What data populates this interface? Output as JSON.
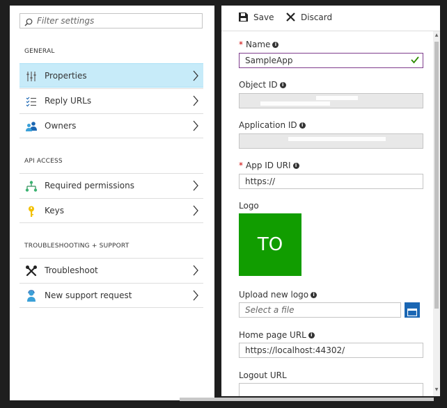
{
  "filter": {
    "placeholder": "Filter settings"
  },
  "sections": {
    "general": "GENERAL",
    "api_access": "API ACCESS",
    "troubleshooting": "TROUBLESHOOTING + SUPPORT"
  },
  "nav": {
    "properties": "Properties",
    "reply_urls": "Reply URLs",
    "owners": "Owners",
    "required_permissions": "Required permissions",
    "keys": "Keys",
    "troubleshoot": "Troubleshoot",
    "new_support_request": "New support request"
  },
  "toolbar": {
    "save": "Save",
    "discard": "Discard"
  },
  "form": {
    "name_label": "Name",
    "name_value": "SampleApp",
    "object_id_label": "Object ID",
    "object_id_value": "        ",
    "application_id_label": "Application ID",
    "application_id_value": "        ",
    "app_id_uri_label": "App ID URI",
    "app_id_uri_value": "https://",
    "logo_label": "Logo",
    "logo_text": "TO",
    "upload_logo_label": "Upload new logo",
    "upload_placeholder": "Select a file",
    "home_page_label": "Home page URL",
    "home_page_value": "https://localhost:44302/",
    "logout_label": "Logout URL",
    "logout_value": ""
  },
  "colors": {
    "selected_bg": "#c7ebf9",
    "logo_bg": "#119d00",
    "focus_border": "#7e3c8c",
    "required": "#cc0000",
    "accent_blue": "#1a66b3"
  }
}
